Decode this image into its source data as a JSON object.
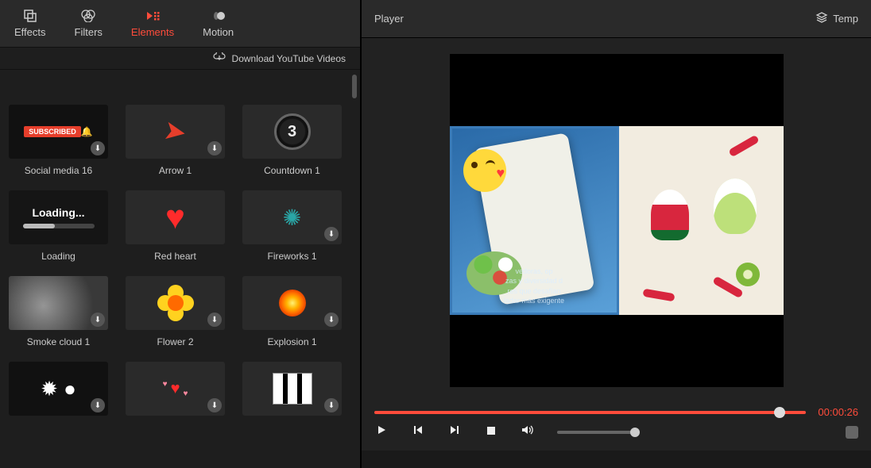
{
  "tabs": {
    "effects": "Effects",
    "filters": "Filters",
    "elements": "Elements",
    "motion": "Motion"
  },
  "download_bar": {
    "label": "Download YouTube Videos"
  },
  "elements": [
    {
      "label": "Social media 16",
      "subscribed_text": "SUBSCRIBED"
    },
    {
      "label": "Arrow 1"
    },
    {
      "label": "Countdown 1",
      "count": "3"
    },
    {
      "label": "Loading",
      "loading_text": "Loading..."
    },
    {
      "label": "Red heart"
    },
    {
      "label": "Fireworks 1"
    },
    {
      "label": "Smoke cloud 1"
    },
    {
      "label": "Flower 2"
    },
    {
      "label": "Explosion 1"
    },
    {
      "label": ""
    },
    {
      "label": ""
    },
    {
      "label": ""
    }
  ],
  "player": {
    "title": "Player",
    "templates_label": "Temp",
    "timecode": "00:00:26",
    "subtitle": "vedoras, op\\n zas y diversidad d\\n res que desafían\\n ladar más exigente"
  }
}
